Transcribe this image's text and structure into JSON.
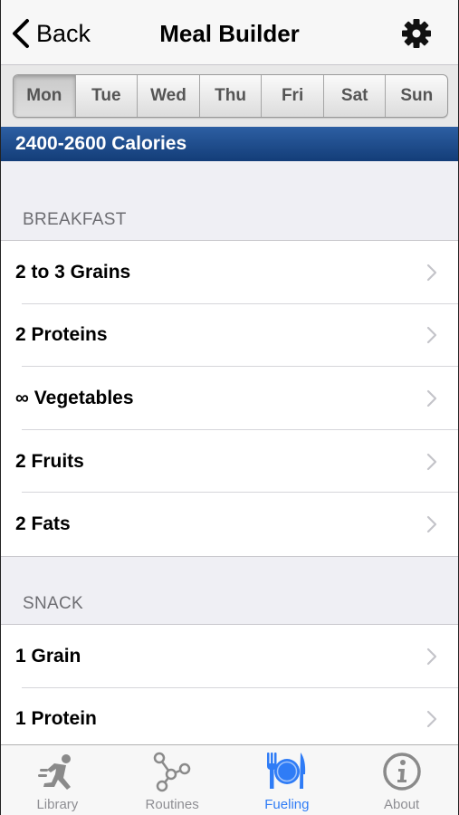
{
  "nav": {
    "back_label": "Back",
    "title": "Meal Builder"
  },
  "days": [
    "Mon",
    "Tue",
    "Wed",
    "Thu",
    "Fri",
    "Sat",
    "Sun"
  ],
  "selected_day": "Mon",
  "calories": "2400-2600 Calories",
  "sections": [
    {
      "header": "BREAKFAST",
      "items": [
        "2 to 3 Grains",
        "2 Proteins",
        "∞ Vegetables",
        "2 Fruits",
        "2 Fats"
      ]
    },
    {
      "header": "SNACK",
      "items": [
        "1 Grain",
        "1 Protein"
      ]
    }
  ],
  "tabs": [
    {
      "label": "Library",
      "icon": "running-figure-icon"
    },
    {
      "label": "Routines",
      "icon": "route-nodes-icon"
    },
    {
      "label": "Fueling",
      "icon": "plate-utensils-icon"
    },
    {
      "label": "About",
      "icon": "info-icon"
    }
  ],
  "active_tab": "Fueling",
  "colors": {
    "accent": "#2f7cf6",
    "banner": "#1f4b8c",
    "tab_inactive": "#8e8e93"
  }
}
